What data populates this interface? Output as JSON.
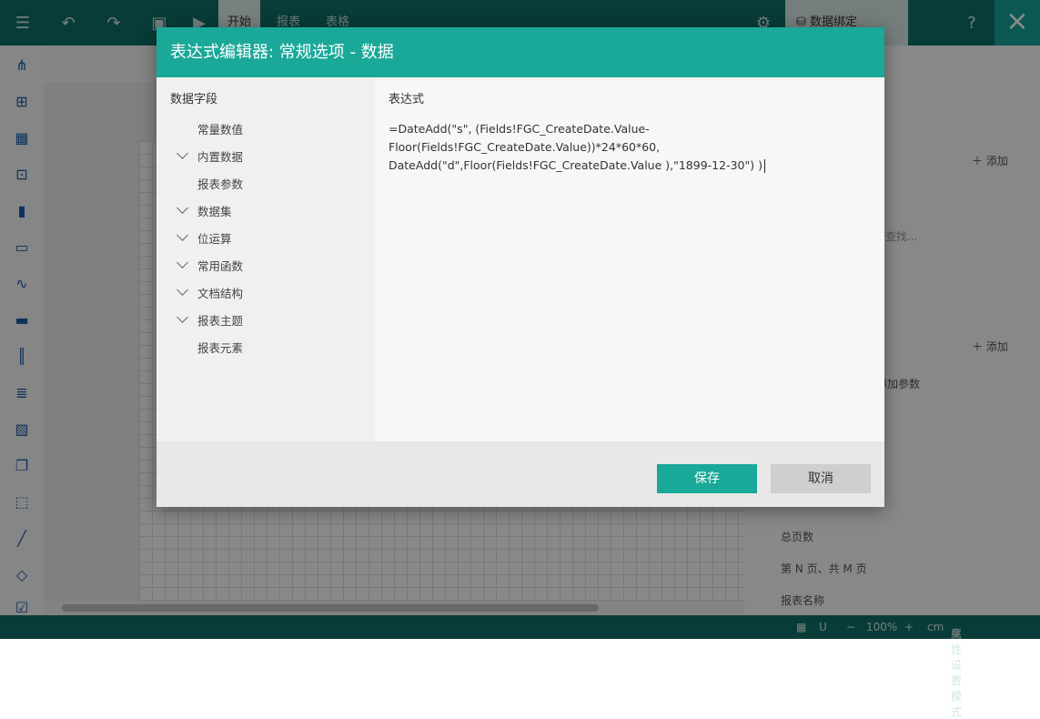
{
  "topbar": {
    "tabs": [
      "开始",
      "报表",
      "表格"
    ],
    "panel_tab": "数据绑定",
    "close": "×"
  },
  "left_toolbar": {
    "icons": [
      "tree-icon",
      "shapes-icon",
      "table-icon",
      "matrix-icon",
      "bar-chart-icon",
      "textbox-icon",
      "sparkline-icon",
      "bullet-icon",
      "barcode-icon",
      "richtext-icon",
      "image-icon",
      "subreport-icon",
      "container-icon",
      "line-icon",
      "shape-icon",
      "checkbox-icon"
    ]
  },
  "right_panel": {
    "add_label_1": "添加",
    "search_placeholder": "查找...",
    "add_label_2": "添加",
    "add_param_text": "添加参数",
    "items": [
      "总页数",
      "第 N 页、共 M 页",
      "报表名称"
    ]
  },
  "statusbar": {
    "zoom_minus": "−",
    "zoom": "100%",
    "zoom_plus": "+",
    "unit": "cm",
    "mode": "属性设置模式"
  },
  "dialog": {
    "title": "表达式编辑器: 常规选项 - 数据",
    "fields_title": "数据字段",
    "expr_title": "表达式",
    "tree": [
      {
        "label": "常量数值",
        "expandable": false
      },
      {
        "label": "内置数据",
        "expandable": true
      },
      {
        "label": "报表参数",
        "expandable": false
      },
      {
        "label": "数据集",
        "expandable": true
      },
      {
        "label": "位运算",
        "expandable": true
      },
      {
        "label": "常用函数",
        "expandable": true
      },
      {
        "label": "文档结构",
        "expandable": true
      },
      {
        "label": "报表主题",
        "expandable": true
      },
      {
        "label": "报表元素",
        "expandable": false
      }
    ],
    "expression": "=DateAdd(\"s\", (Fields!FGC_CreateDate.Value-\nFloor(Fields!FGC_CreateDate.Value))*24*60*60,\nDateAdd(\"d\",Floor(Fields!FGC_CreateDate.Value ),\"1899-12-30\") )",
    "save": "保存",
    "cancel": "取消"
  }
}
